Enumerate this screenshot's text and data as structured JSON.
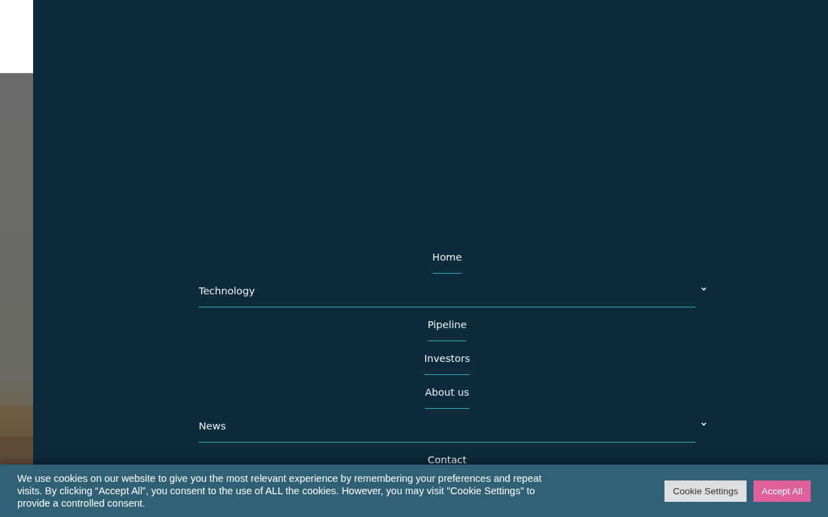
{
  "menu": [
    {
      "label": "Home",
      "kind": "link"
    },
    {
      "label": "Technology",
      "kind": "submenu"
    },
    {
      "label": "Pipeline",
      "kind": "link"
    },
    {
      "label": "Investors",
      "kind": "link"
    },
    {
      "label": "About us",
      "kind": "link"
    },
    {
      "label": "News",
      "kind": "submenu"
    },
    {
      "label": "Contact",
      "kind": "link"
    }
  ],
  "cookie_banner": {
    "text": "We use cookies on our website to give you the most relevant experience by remembering your preferences and repeat visits. By clicking “Accept All”, you consent to the use of ALL the cookies. However, you may visit \"Cookie Settings\" to provide a controlled consent.",
    "buttons": [
      {
        "label": "Cookie Settings",
        "kind": "secondary"
      },
      {
        "label": "Accept All",
        "kind": "primary"
      }
    ]
  }
}
